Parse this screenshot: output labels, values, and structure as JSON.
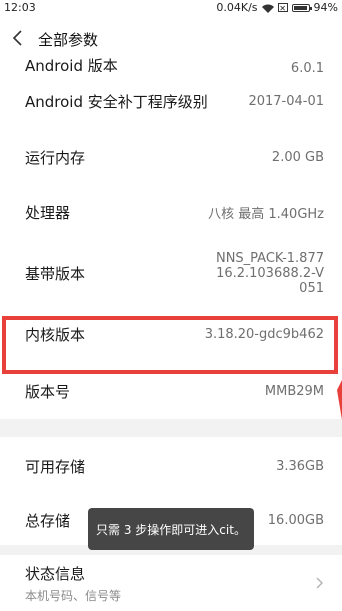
{
  "status_bar": {
    "time": "12:03",
    "speed": "0.04K/s",
    "battery_percent": "94%",
    "battery_level": 0.94,
    "icons": [
      "wifi-icon",
      "no-sim-icon",
      "battery-icon"
    ]
  },
  "header": {
    "title": "全部参数",
    "back_icon": "chevron-left-icon"
  },
  "rows": [
    {
      "label": "Android 版本",
      "value": "6.0.1"
    },
    {
      "label": "Android 安全补丁程序级别",
      "value": "2017-04-01"
    },
    {
      "label": "运行内存",
      "value": "2.00 GB"
    },
    {
      "label": "处理器",
      "value": "八核 最高 1.40GHz"
    },
    {
      "label": "基带版本",
      "value": "NNS_PACK-1.87716.2.103688.2-V051"
    },
    {
      "label": "内核版本",
      "value": "3.18.20-gdc9b462"
    },
    {
      "label": "版本号",
      "value": "MMB29M"
    },
    {
      "label": "可用存储",
      "value": "3.36GB"
    },
    {
      "label": "总存储",
      "value": "16.00GB"
    },
    {
      "label": "状态信息",
      "sub": "本机号码、信号等"
    }
  ],
  "toast": {
    "text": "只需 3 步操作即可进入cit。"
  },
  "colors": {
    "highlight": "#e8403a",
    "toast_bg": "#3d3d3d",
    "section_gap": "#f2f2f2"
  }
}
